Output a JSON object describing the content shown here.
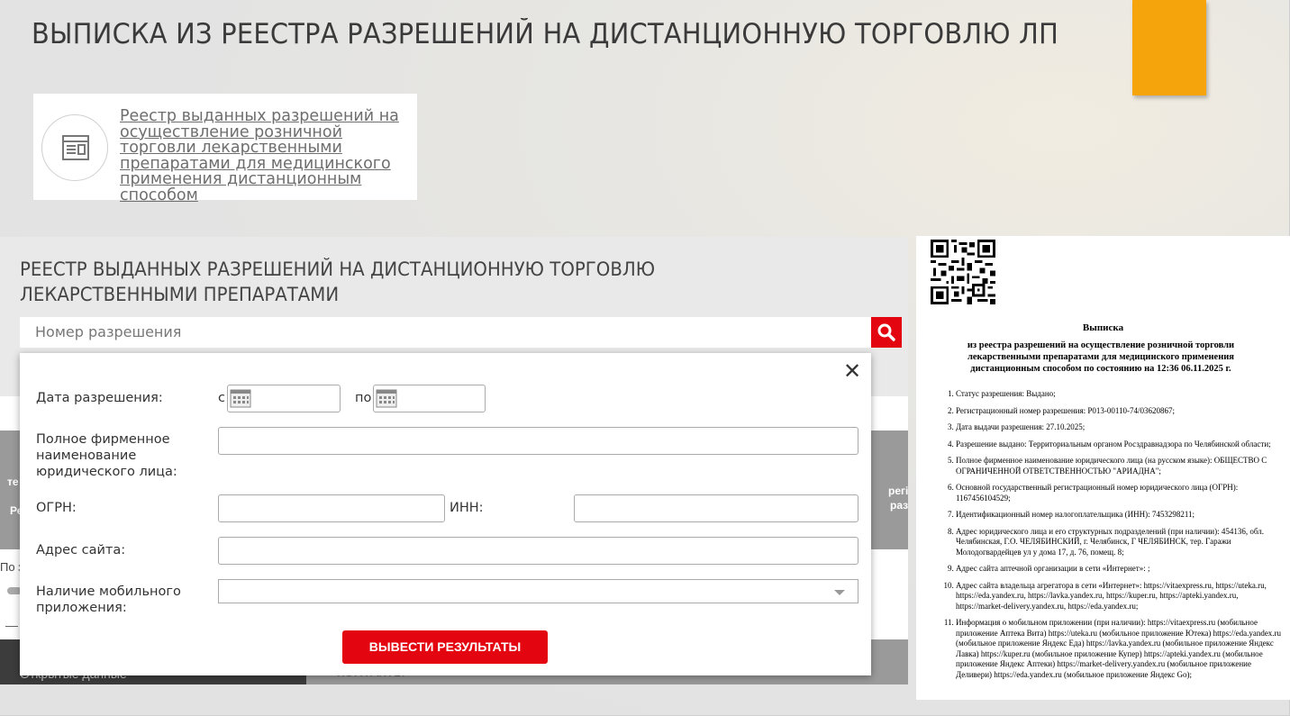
{
  "slide": {
    "title": "ВЫПИСКА ИЗ РЕЕСТРА РАЗРЕШЕНИЙ НА ДИСТАНЦИОННУЮ ТОРГОВЛЮ ЛП",
    "accent_color": "#f5a40b"
  },
  "registry_link": {
    "icon": "document-browser-icon",
    "text": "Реестр выданных разрешений на осуществление розничной торговли лекарственными препаратами для медицинского применения дистанционным способом"
  },
  "registry_page": {
    "heading": "РЕЕСТР ВЫДАННЫХ РАЗРЕШЕНИЙ НА ДИСТАНЦИОННУЮ ТОРГОВЛЮ ЛЕКАРСТВЕННЫМИ ПРЕПАРАТАМИ",
    "search_placeholder": "Номер разрешения",
    "search_icon": "search-icon",
    "accent_color": "#e30611",
    "background_fragments": {
      "col_a": "Ре",
      "col_b": "те",
      "col_c": "регі",
      "col_d": "разі",
      "row_label": "По з",
      "footer_open_data": "Открытые данные",
      "footer_contacts": "КОНТАКТЫ"
    },
    "filter": {
      "close_icon": "close-icon",
      "date_label": "Дата разрешения:",
      "date_from_prefix": "с",
      "date_to_prefix": "по",
      "calendar_icon": "calendar-icon",
      "company_name_label": "Полное фирменное наименование юридического лица:",
      "ogrn_label": "ОГРН:",
      "inn_label": "ИНН:",
      "site_label": "Адрес сайта:",
      "mobile_app_label": "Наличие мобильного приложения:",
      "submit_label": "ВЫВЕСТИ РЕЗУЛЬТАТЫ"
    }
  },
  "extract": {
    "qr_icon": "qr-code-icon",
    "title": "Выписка",
    "subtitle": "из реестра разрешений на осуществление розничной торговли лекарственными препаратами для медицинского применения дистанционным способом по состоянию на 12:36 06.11.2025 г.",
    "items": [
      "Статус разрешения: Выдано;",
      "Регистрационный номер разрешения: Р013-00110-74/03620867;",
      "Дата выдачи разрешения: 27.10.2025;",
      "Разрешение выдано: Территориальным органом Росздравнадзора по Челябинской области;",
      "Полное фирменное наименование юридического лица (на русском языке): ОБЩЕСТВО С ОГРАНИЧЕННОЙ ОТВЕТСТВЕННОСТЬЮ \"АРИАДНА\";",
      "Основной государственный регистрационный номер юридического лица (ОГРН): 1167456104529;",
      "Идентификационный номер налогоплательщика (ИНН): 7453298211;",
      "Адрес юридического лица и его структурных подразделений (при наличии): 454136, обл. Челябинская, Г.О. ЧЕЛЯБИНСКИЙ, г. Челябинск, Г ЧЕЛЯБИНСК, тер. Гаражи Молодогвардейцев ул у дома 17, д. 76, помещ. 8;",
      "Адрес сайта аптечной организации в сети «Интернет»: ;",
      "Адрес сайта владельца агрегатора в сети «Интернет»: https://vitaexpress.ru, https://uteka.ru, https://eda.yandex.ru, https://lavka.yandex.ru, https://kuper.ru, https://apteki.yandex.ru, https://market-delivery.yandex.ru, https://eda.yandex.ru;",
      "Информация о мобильном приложении (при наличии): https://vitaexpress.ru (мобильное приложение Аптека Вита) https://uteka.ru (мобильное приложение Ютека) https://eda.yandex.ru (мобильное приложение Яндекс Еда) https://lavka.yandex.ru (мобильное приложение Яндекс Лавка) https://kuper.ru (мобильное приложение Купер) https://apteki.yandex.ru (мобильное приложение Яндекс Аптеки) https://market-delivery.yandex.ru (мобильное приложение Деливери) https://eda.yandex.ru (мобильное приложение Яндекс Go);"
    ]
  }
}
